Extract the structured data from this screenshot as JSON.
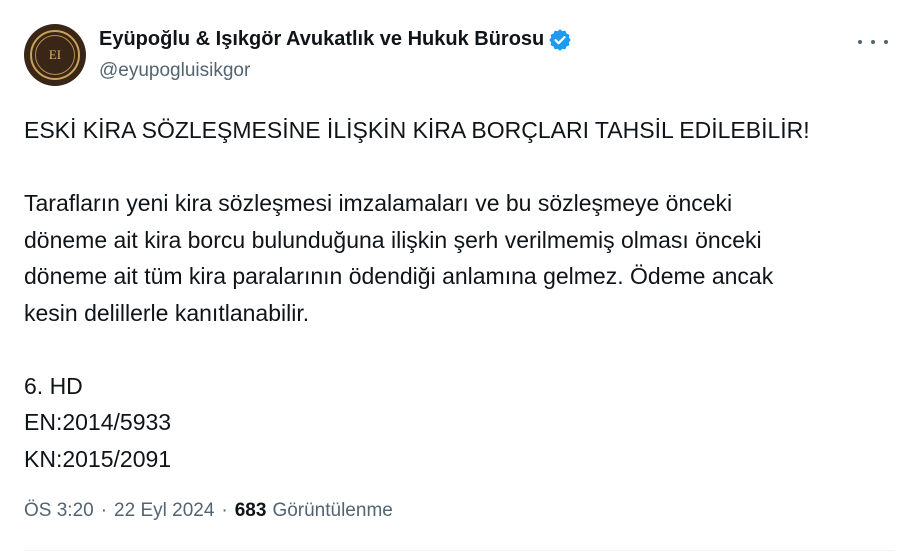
{
  "author": {
    "display_name": "Eyüpoğlu & Işıkgör Avukatlık ve Hukuk Bürosu",
    "handle": "@eyupogluisikgor",
    "avatar_monogram": "EI",
    "verified": true,
    "verified_color": "#1d9bf0"
  },
  "tweet": {
    "headline": "ESKİ KİRA SÖZLEŞMESİNE İLİŞKİN KİRA BORÇLARI TAHSİL EDİLEBİLİR!",
    "body_lines": [
      "Tarafların yeni kira sözleşmesi imzalamaları ve bu sözleşmeye önceki",
      "döneme ait kira borcu bulunduğuna ilişkin şerh verilmemiş olması önceki",
      "döneme ait tüm kira paralarının ödendiği anlamına gelmez. Ödeme ancak",
      "kesin delillerle kanıtlanabilir."
    ],
    "ref_lines": [
      "6. HD",
      "EN:2014/5933",
      "KN:2015/2091"
    ]
  },
  "meta": {
    "time": "ÖS 3:20",
    "separator": "·",
    "date": "22 Eyl 2024",
    "views_count": "683",
    "views_label": "Görüntülenme"
  },
  "icons": {
    "more": "more-horizontal-icon",
    "verified": "verified-badge-icon"
  }
}
